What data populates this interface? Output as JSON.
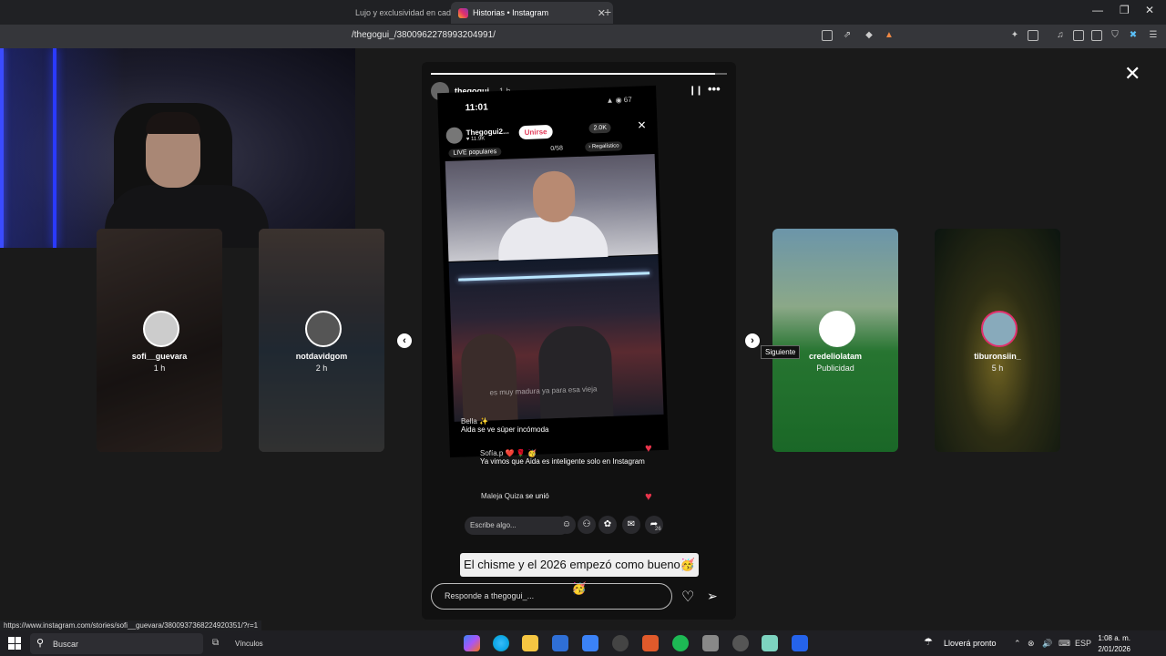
{
  "browser": {
    "tabs": [
      {
        "label": "Lujo y exclusividad en cad",
        "active": false
      },
      {
        "label": "Historias • Instagram",
        "active": true
      }
    ],
    "new_tab": "+",
    "window_controls": [
      "—",
      "❐",
      "✕"
    ],
    "url": "/thegogui_/3800962278993204991/"
  },
  "story_viewer": {
    "close": "✕",
    "prev_arrow": "‹",
    "next_arrow": "›",
    "next_tooltip": "Siguiente",
    "side_stories": [
      {
        "username": "sofi__guevara",
        "time": "1 h"
      },
      {
        "username": "notdavidgom",
        "time": "2 h"
      },
      {
        "username": "credeliolatam",
        "time": "Publicidad"
      },
      {
        "username": "tiburonsiin_",
        "time": "5 h"
      }
    ],
    "main": {
      "username": "thegogui_",
      "time": "1 h",
      "progress": 0.96,
      "live": {
        "clock": "11:01",
        "status_icons": "▲ ◉ 67",
        "host": "Thegogui2...",
        "followers": "♥ 11.9K",
        "join_button": "Unirse",
        "viewers": "2.0K",
        "close": "✕",
        "live_tag": "LIVE populares",
        "count": "0/58",
        "ranking": "› Regalístico",
        "video_caption": "es muy madura ya para esa vieja"
      },
      "comments": [
        {
          "user": "Bella ✨",
          "text": "Aida se ve súper incómoda",
          "liked": false
        },
        {
          "user": "Sofía.p ❤️ 🌹 🥳",
          "text": "Ya vimos que Aida es inteligente solo en Instagram",
          "liked": true
        },
        {
          "user": "Maleja Quiza",
          "text": "se unió",
          "liked": true
        }
      ],
      "compose_placeholder": "Escribe algo...",
      "share_count": "26",
      "caption": "El chisme y el 2026 empezó como bueno🥳🥳",
      "reply_placeholder": "Responde a thegogui_..."
    }
  },
  "status_url": "https://www.instagram.com/stories/sofi__guevara/3800937368224920351/?r=1",
  "taskbar": {
    "search_label": "Buscar",
    "links_label": "Vínculos",
    "weather": "Lloverá pronto",
    "language": "ESP",
    "time": "1:08 a. m.",
    "date": "2/01/2026"
  },
  "colors": {
    "accent_heart": "#e8344b",
    "join_text": "#e23a58",
    "background": "#1a1a1a"
  }
}
